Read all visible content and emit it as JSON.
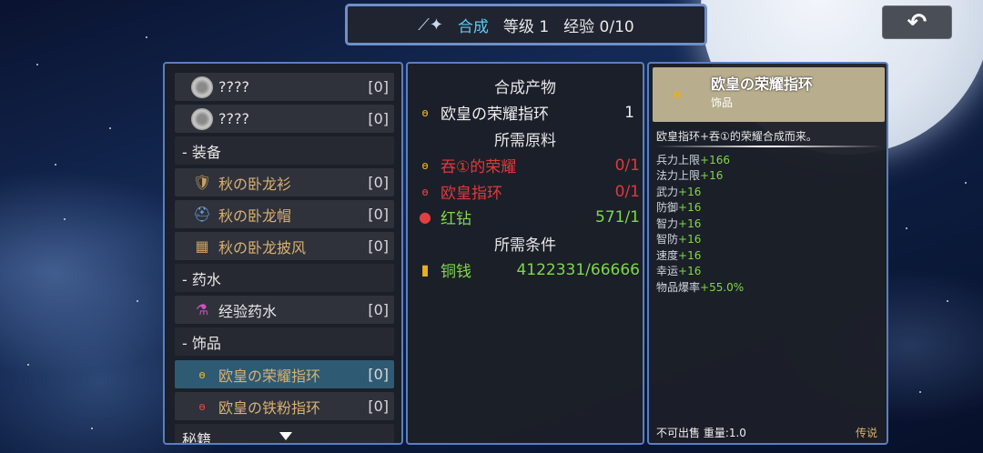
{
  "header": {
    "title": "合成",
    "level": "等级 1",
    "exp": "经验 0/10"
  },
  "left_list": [
    {
      "type": "item",
      "name": "????",
      "count": "[0]",
      "icon": "coin-icon"
    },
    {
      "type": "item",
      "name": "????",
      "count": "[0]",
      "icon": "coin-icon"
    },
    {
      "type": "category",
      "name": "- 装备"
    },
    {
      "type": "item",
      "name": "秋の卧龙衫",
      "count": "[0]",
      "icon": "armor-icon"
    },
    {
      "type": "item",
      "name": "秋の卧龙帽",
      "count": "[0]",
      "icon": "helmet-icon"
    },
    {
      "type": "item",
      "name": "秋の卧龙披风",
      "count": "[0]",
      "icon": "cloak-icon"
    },
    {
      "type": "category",
      "name": "- 药水"
    },
    {
      "type": "item",
      "name": "经验药水",
      "count": "[0]",
      "icon": "potion-icon"
    },
    {
      "type": "category",
      "name": "- 饰品"
    },
    {
      "type": "item",
      "name": "欧皇の荣耀指环",
      "count": "[0]",
      "icon": "ring-icon",
      "selected": true
    },
    {
      "type": "item",
      "name": "欧皇の铁粉指环",
      "count": "[0]",
      "icon": "ring-icon"
    },
    {
      "type": "category",
      "name": "秘籍"
    }
  ],
  "middle": {
    "product_heading": "合成产物",
    "product": {
      "name": "欧皇の荣耀指环",
      "qty": "1"
    },
    "materials_heading": "所需原料",
    "materials": [
      {
        "name": "吞①的荣耀",
        "qty": "0/1",
        "status": "missing",
        "icon": "ring-icon"
      },
      {
        "name": "欧皇指环",
        "qty": "0/1",
        "status": "missing",
        "icon": "ring-icon"
      },
      {
        "name": "红钻",
        "qty": "571/1",
        "status": "ok",
        "icon": "red-gem-icon"
      }
    ],
    "conditions_heading": "所需条件",
    "conditions": [
      {
        "name": "铜钱",
        "qty": "4122331/66666",
        "icon": "coin-stack-icon"
      }
    ]
  },
  "right": {
    "item_name": "欧皇の荣耀指环",
    "item_type": "饰品",
    "description": "欧皇指环+吞①的荣耀合成而来。",
    "stats": [
      {
        "label": "兵力上限",
        "value": "+166"
      },
      {
        "label": "法力上限",
        "value": "+16"
      },
      {
        "label": "武力",
        "value": "+16"
      },
      {
        "label": "防御",
        "value": "+16"
      },
      {
        "label": "智力",
        "value": "+16"
      },
      {
        "label": "智防",
        "value": "+16"
      },
      {
        "label": "速度",
        "value": "+16"
      },
      {
        "label": "幸运",
        "value": "+16"
      },
      {
        "label": "物品爆率",
        "value": "+55.0%"
      }
    ],
    "footer": "不可出售 重量:1.0",
    "rarity": "传说"
  }
}
